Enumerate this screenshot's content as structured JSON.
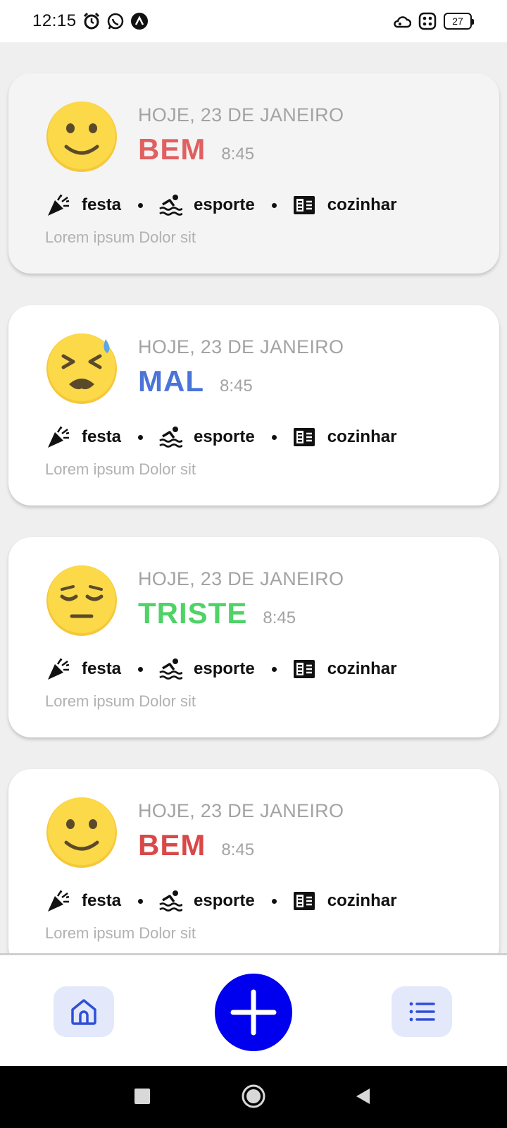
{
  "status_bar": {
    "time": "12:15",
    "battery": "27",
    "icons": [
      "alarm-icon",
      "whatsapp-icon",
      "app-notification-icon",
      "cloud-sync-icon",
      "apps-grid-icon",
      "battery-icon"
    ]
  },
  "entries": [
    {
      "date": "HOJE, 23 DE JANEIRO",
      "mood": "BEM",
      "mood_color": "#e06060",
      "time": "8:45",
      "emoji": "slightly-smiling-face-icon",
      "tags": [
        {
          "label": "festa",
          "icon": "party-popper-icon"
        },
        {
          "label": "esporte",
          "icon": "swimming-icon"
        },
        {
          "label": "cozinhar",
          "icon": "recipe-book-icon"
        }
      ],
      "note": "Lorem ipsum Dolor sit"
    },
    {
      "date": "HOJE, 23 DE JANEIRO",
      "mood": "MAL",
      "mood_color": "#4a74d8",
      "time": "8:45",
      "emoji": "tired-sweat-face-icon",
      "tags": [
        {
          "label": "festa",
          "icon": "party-popper-icon"
        },
        {
          "label": "esporte",
          "icon": "swimming-icon"
        },
        {
          "label": "cozinhar",
          "icon": "recipe-book-icon"
        }
      ],
      "note": "Lorem ipsum Dolor sit"
    },
    {
      "date": "HOJE, 23 DE JANEIRO",
      "mood": "TRISTE",
      "mood_color": "#4fd267",
      "time": "8:45",
      "emoji": "pensive-face-icon",
      "tags": [
        {
          "label": "festa",
          "icon": "party-popper-icon"
        },
        {
          "label": "esporte",
          "icon": "swimming-icon"
        },
        {
          "label": "cozinhar",
          "icon": "recipe-book-icon"
        }
      ],
      "note": "Lorem ipsum Dolor sit"
    },
    {
      "date": "HOJE, 23 DE JANEIRO",
      "mood": "BEM",
      "mood_color": "#d94848",
      "time": "8:45",
      "emoji": "slightly-smiling-face-icon",
      "tags": [
        {
          "label": "festa",
          "icon": "party-popper-icon"
        },
        {
          "label": "esporte",
          "icon": "swimming-icon"
        },
        {
          "label": "cozinhar",
          "icon": "recipe-book-icon"
        }
      ],
      "note": "Lorem ipsum Dolor sit"
    }
  ],
  "bottom_nav": {
    "home_icon": "home-icon",
    "add_icon": "plus-icon",
    "list_icon": "list-icon",
    "accent_color": "#0000ee",
    "nav_icon_color": "#2f4fd6"
  },
  "system_nav": [
    "recents-square-icon",
    "home-circle-icon",
    "back-triangle-icon"
  ]
}
